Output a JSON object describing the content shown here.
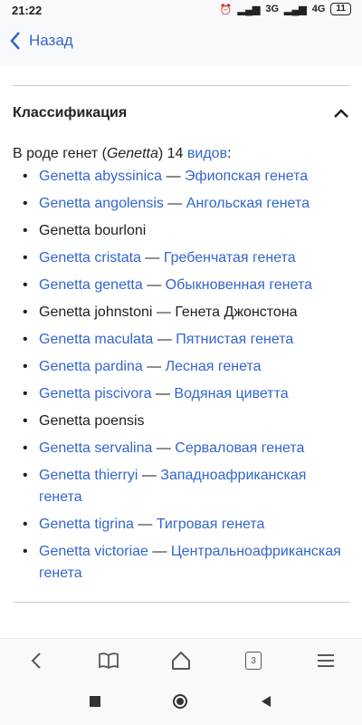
{
  "status_bar": {
    "time": "21:22",
    "network_1": "3G",
    "network_2": "4G",
    "battery": "11"
  },
  "app_bar": {
    "back_label": "Назад"
  },
  "section": {
    "title": "Классификация"
  },
  "intro": {
    "prefix": "В роде генет (",
    "genus": "Genetta",
    "middle": ") 14 ",
    "link": "видов",
    "suffix": ":"
  },
  "species": [
    {
      "latin": "Genetta abyssinica",
      "sep": " — ",
      "common": "Эфиопская генета",
      "linked": true
    },
    {
      "latin": "Genetta angolensis",
      "sep": " — ",
      "common": "Ангольская генета",
      "linked": true
    },
    {
      "latin": "Genetta bourloni",
      "sep": "",
      "common": "",
      "linked": false
    },
    {
      "latin": "Genetta cristata",
      "sep": " — ",
      "common": "Гребенчатая генета",
      "linked": true
    },
    {
      "latin": "Genetta genetta",
      "sep": " — ",
      "common": "Обыкновенная генета",
      "linked": true
    },
    {
      "latin": "Genetta johnstoni",
      "sep": " — ",
      "common": "Генета Джонстона",
      "linked": false
    },
    {
      "latin": "Genetta maculata",
      "sep": " — ",
      "common": "Пятнистая генета",
      "linked": true
    },
    {
      "latin": "Genetta pardina",
      "sep": " — ",
      "common": "Лесная генета",
      "linked": true
    },
    {
      "latin": "Genetta piscivora",
      "sep": " — ",
      "common": "Водяная циветта",
      "linked": true
    },
    {
      "latin": "Genetta poensis",
      "sep": "",
      "common": "",
      "linked": false
    },
    {
      "latin": "Genetta servalina",
      "sep": " — ",
      "common": "Сервaловая генета",
      "linked": true
    },
    {
      "latin": "Genetta thierryi",
      "sep": " — ",
      "common": "Западноафриканская генета",
      "linked": true
    },
    {
      "latin": "Genetta tigrina",
      "sep": " — ",
      "common": "Тигровая генета",
      "linked": true
    },
    {
      "latin": "Genetta victoriae",
      "sep": " — ",
      "common": "Центральноафриканская генета",
      "linked": true
    }
  ],
  "bottom_nav": {
    "tab_count": "3"
  },
  "colors": {
    "link": "#3366cc",
    "text": "#202122",
    "background": "#f8f9fa"
  }
}
